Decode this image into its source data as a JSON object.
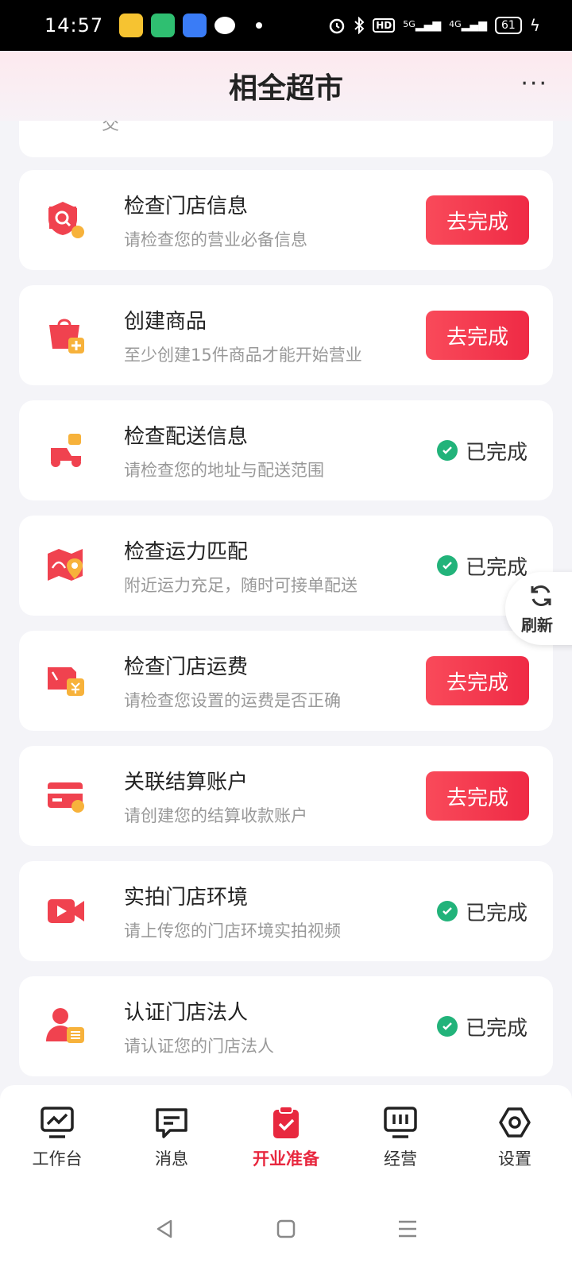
{
  "status_bar": {
    "time": "14:57",
    "hd": "HD",
    "net1": "5G",
    "net2": "4G",
    "battery": "61"
  },
  "header": {
    "title": "相全超市"
  },
  "partial_card": {
    "subtitle_tail": "交"
  },
  "tasks": [
    {
      "title": "检查门店信息",
      "subtitle": "请检查您的营业必备信息",
      "status": "pending",
      "action_label": "去完成"
    },
    {
      "title": "创建商品",
      "subtitle": "至少创建15件商品才能开始营业",
      "status": "pending",
      "action_label": "去完成"
    },
    {
      "title": "检查配送信息",
      "subtitle": "请检查您的地址与配送范围",
      "status": "done",
      "action_label": "已完成"
    },
    {
      "title": "检查运力匹配",
      "subtitle": "附近运力充足，随时可接单配送",
      "status": "done",
      "action_label": "已完成"
    },
    {
      "title": "检查门店运费",
      "subtitle": "请检查您设置的运费是否正确",
      "status": "pending",
      "action_label": "去完成"
    },
    {
      "title": "关联结算账户",
      "subtitle": "请创建您的结算收款账户",
      "status": "pending",
      "action_label": "去完成"
    },
    {
      "title": "实拍门店环境",
      "subtitle": "请上传您的门店环境实拍视频",
      "status": "done",
      "action_label": "已完成"
    },
    {
      "title": "认证门店法人",
      "subtitle": "请认证您的门店法人",
      "status": "done",
      "action_label": "已完成"
    }
  ],
  "refresh": {
    "label": "刷新"
  },
  "bottom_nav": [
    {
      "label": "工作台",
      "icon": "chart-icon",
      "active": false
    },
    {
      "label": "消息",
      "icon": "message-icon",
      "active": false
    },
    {
      "label": "开业准备",
      "icon": "clipboard-check-icon",
      "active": true
    },
    {
      "label": "经营",
      "icon": "bars-icon",
      "active": false
    },
    {
      "label": "设置",
      "icon": "settings-icon",
      "active": false
    }
  ],
  "colors": {
    "accent": "#ef2a45",
    "done": "#22b37a",
    "icon_red": "#f0424f",
    "icon_orange": "#f7b23b"
  }
}
